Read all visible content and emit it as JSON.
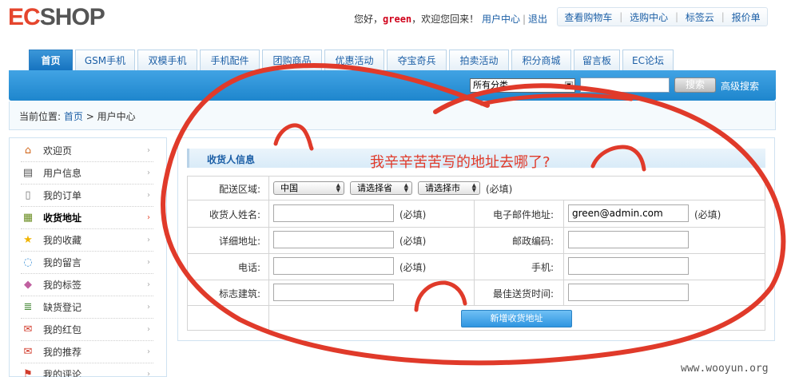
{
  "header": {
    "logo_ec": "EC",
    "logo_rest": "SHOP",
    "greeting_prefix": "您好，",
    "username": "green",
    "greeting_suffix": "，欢迎您回来！",
    "user_center": "用户中心",
    "logout": "退出",
    "toplinks": [
      "查看购物车",
      "选购中心",
      "标签云",
      "报价单"
    ]
  },
  "nav": {
    "tabs": [
      "首页",
      "GSM手机",
      "双模手机",
      "手机配件",
      "团购商品",
      "优惠活动",
      "夺宝奇兵",
      "拍卖活动",
      "积分商城",
      "留言板",
      "EC论坛"
    ],
    "active_index": 0
  },
  "search": {
    "category_selected": "所有分类",
    "query": "",
    "button_label": "搜索",
    "advanced_label": "高级搜索"
  },
  "breadcrumb": {
    "prefix": "当前位置:",
    "home": "首页",
    "separator": ">",
    "current": "用户中心"
  },
  "sidebar": {
    "items": [
      {
        "label": "欢迎页",
        "icon": "home-icon",
        "glyph": "⌂",
        "color": "#d2691e"
      },
      {
        "label": "用户信息",
        "icon": "id-card-icon",
        "glyph": "▤",
        "color": "#555555"
      },
      {
        "label": "我的订单",
        "icon": "document-icon",
        "glyph": "▯",
        "color": "#777777"
      },
      {
        "label": "收货地址",
        "icon": "address-book-icon",
        "glyph": "▦",
        "color": "#6b8e23",
        "active": true
      },
      {
        "label": "我的收藏",
        "icon": "star-icon",
        "glyph": "★",
        "color": "#f0b400"
      },
      {
        "label": "我的留言",
        "icon": "speech-bubble-icon",
        "glyph": "◌",
        "color": "#3a8fd6"
      },
      {
        "label": "我的标签",
        "icon": "tag-icon",
        "glyph": "◆",
        "color": "#c060a0"
      },
      {
        "label": "缺货登记",
        "icon": "list-icon",
        "glyph": "≣",
        "color": "#4a8a3a"
      },
      {
        "label": "我的红包",
        "icon": "red-packet-icon",
        "glyph": "✉",
        "color": "#d23c2c"
      },
      {
        "label": "我的推荐",
        "icon": "recommend-icon",
        "glyph": "✉",
        "color": "#d23c2c"
      },
      {
        "label": "我的评论",
        "icon": "flag-icon",
        "glyph": "⚑",
        "color": "#d23c2c"
      }
    ]
  },
  "form": {
    "section_title": "收货人信息",
    "region_label": "配送区域:",
    "country": "中国",
    "province": "请选择省",
    "city": "请选择市",
    "required": "(必填)",
    "consignee_label": "收货人姓名:",
    "consignee_value": "",
    "email_label": "电子邮件地址:",
    "email_value": "green@admin.com",
    "address_label": "详细地址:",
    "address_value": "",
    "zipcode_label": "邮政编码:",
    "zipcode_value": "",
    "phone_label": "电话:",
    "phone_value": "",
    "mobile_label": "手机:",
    "mobile_value": "",
    "building_label": "标志建筑:",
    "building_value": "",
    "best_time_label": "最佳送货时间:",
    "best_time_value": "",
    "submit_label": "新增收货地址"
  },
  "annotation": "我辛辛苦苦写的地址去哪了?",
  "watermark": "www.wooyun.org",
  "colors": {
    "accent_blue": "#1e86cd",
    "link_blue": "#1c5fa6",
    "annotation_red": "#e03a2a"
  }
}
